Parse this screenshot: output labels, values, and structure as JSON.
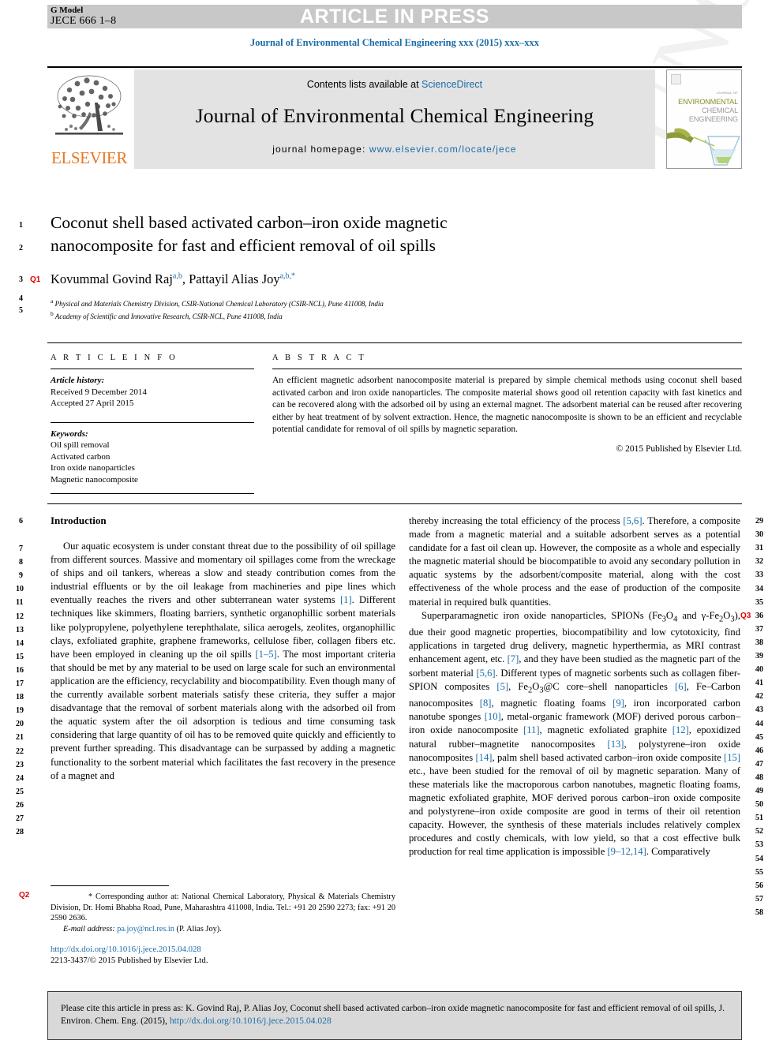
{
  "header": {
    "g_model_label": "G Model",
    "g_model_code": "JECE 666 1–8",
    "article_in_press": "ARTICLE IN PRESS",
    "journal_citation": "Journal of Environmental Chemical Engineering xxx (2015) xxx–xxx"
  },
  "masthead": {
    "publisher": "ELSEVIER",
    "contents_prefix": "Contents lists available at ",
    "contents_link": "ScienceDirect",
    "journal_title": "Journal of Environmental Chemical Engineering",
    "homepage_prefix": "journal homepage: ",
    "homepage_url": "www.elsevier.com/locate/jece",
    "cover": {
      "kicker": "JOURNAL OF",
      "line1": "ENVIRONMENTAL",
      "line2": "CHEMICAL",
      "line3": "ENGINEERING"
    }
  },
  "article": {
    "title_line1": "Coconut shell based activated carbon–iron oxide magnetic",
    "title_line2": "nanocomposite for fast and efficient removal of oil spills",
    "authors": "Kovummal Govind Raj",
    "author1_sup": "a,b",
    "authors2": ", Pattayil Alias Joy",
    "author2_sup": "a,b,*",
    "affiliation_a_sup": "a",
    "affiliation_a": " Physical and Materials Chemistry Division, CSIR-National Chemical Laboratory (CSIR-NCL), Pune 411008, India",
    "affiliation_b_sup": "b",
    "affiliation_b": " Academy of Scientific and Innovative Research, CSIR-NCL, Pune 411008, India"
  },
  "article_info": {
    "heading": "A R T I C L E  I N F O",
    "history_label": "Article history:",
    "received": "Received 9 December 2014",
    "accepted": "Accepted 27 April 2015",
    "keywords_label": "Keywords:",
    "keywords": [
      "Oil spill removal",
      "Activated carbon",
      "Iron oxide nanoparticles",
      "Magnetic nanocomposite"
    ]
  },
  "abstract": {
    "heading": "A B S T R A C T",
    "text": "An efficient magnetic adsorbent nanocomposite material is prepared by simple chemical methods using coconut shell based activated carbon and iron oxide nanoparticles. The composite material shows good oil retention capacity with fast kinetics and can be recovered along with the adsorbed oil by using an external magnet. The adsorbent material can be reused after recovering either by heat treatment of by solvent extraction. Hence, the magnetic nanocomposite is shown to be an efficient and recyclable potential candidate for removal of oil spills by magnetic separation.",
    "copyright": "© 2015 Published by Elsevier Ltd."
  },
  "body": {
    "intro_heading": "Introduction",
    "left_p1_a": "Our aquatic ecosystem is under constant threat due to the possibility of oil spillage from different sources. Massive and momentary oil spillages come from the wreckage of ships and oil tankers, whereas a slow and steady contribution comes from the industrial effluents or by the oil leakage from machineries and pipe lines which eventually reaches the rivers and other subterranean water systems ",
    "left_ref1": "[1]",
    "left_p1_b": ". Different techniques like skimmers, floating barriers, synthetic organophillic sorbent materials like polypropylene, polyethylene terephthalate, silica aerogels, zeolites, organophillic clays, exfoliated graphite, graphene frameworks, cellulose fiber, collagen fibers etc. have been employed in cleaning up the oil spills ",
    "left_ref2": "[1–5]",
    "left_p1_c": ". The most important criteria that should be met by any material to be used on large scale for such an environmental application are the efficiency, recyclability and biocompatibility. Even though many of the currently available sorbent materials satisfy these criteria, they suffer a major disadvantage that the removal of sorbent materials along with the adsorbed oil from the aquatic system after the oil adsorption is tedious and time consuming task considering that large quantity of oil has to be removed quite quickly and efficiently to prevent further spreading. This disadvantage can be surpassed by adding a magnetic functionality to the sorbent material which facilitates the fast recovery in the presence of a magnet and",
    "right_p1_a": "thereby increasing the total efficiency of the process ",
    "right_ref1": "[5,6]",
    "right_p1_b": ". Therefore, a composite made from a magnetic material and a suitable adsorbent serves as a potential candidate for a fast oil clean up. However, the composite as a whole and especially the magnetic material should be biocompatible to avoid any secondary pollution in aquatic systems by the adsorbent/composite material, along with the cost effectiveness of the whole process and the ease of production of the composite material in required bulk quantities.",
    "right_p2_a": "Superparamagnetic iron oxide nanoparticles, SPIONs (Fe",
    "right_p2_sub1": "3",
    "right_p2_b": "O",
    "right_p2_sub2": "4",
    "right_p2_c": " and γ-Fe",
    "right_p2_sub3": "2",
    "right_p2_d": "O",
    "right_p2_sub4": "3",
    "right_p2_e": "), due their good magnetic properties, biocompatibility and low cytotoxicity, find applications in targeted drug delivery, magnetic hyperthermia, as MRI contrast enhancement agent, etc. ",
    "right_ref2": "[7]",
    "right_p2_f": ", and they have been studied as the magnetic part of the sorbent material ",
    "right_ref3": "[5,6]",
    "right_p2_g": ". Different types of magnetic sorbents such as collagen fiber-SPION composites ",
    "right_ref4": "[5]",
    "right_p2_h": ", Fe",
    "right_p2_sub5": "2",
    "right_p2_i": "O",
    "right_p2_sub6": "3",
    "right_p2_j": "@C core–shell nanoparticles ",
    "right_ref5": "[6]",
    "right_p2_k": ", Fe–Carbon nanocomposites ",
    "right_ref6": "[8]",
    "right_p2_l": ", magnetic floating foams ",
    "right_ref7": "[9]",
    "right_p2_m": ", iron incorporated carbon nanotube sponges ",
    "right_ref8": "[10]",
    "right_p2_n": ", metal-organic framework (MOF) derived porous carbon–iron oxide nanocomposite ",
    "right_ref9": "[11]",
    "right_p2_o": ", magnetic exfoliated graphite ",
    "right_ref10": "[12]",
    "right_p2_p": ", epoxidized natural rubber–magnetite nanocomposites ",
    "right_ref11": "[13]",
    "right_p2_q": ", polystyrene–iron oxide nanocomposites ",
    "right_ref12": "[14]",
    "right_p2_r": ", palm shell based activated carbon–iron oxide composite ",
    "right_ref13": "[15]",
    "right_p2_s": " etc., have been studied for the removal of oil by magnetic separation. Many of these materials like the macroporous carbon nanotubes, magnetic floating foams, magnetic exfoliated graphite, MOF derived porous carbon–iron oxide composite and polystyrene–iron oxide composite are good in terms of their oil retention capacity. However, the synthesis of these materials includes relatively complex procedures and costly chemicals, with low yield, so that a cost effective bulk production for real time application is impossible ",
    "right_ref14": "[9–12,14]",
    "right_p2_t": ". Comparatively"
  },
  "footnote": {
    "marker": "*",
    "text": " Corresponding author at: National Chemical Laboratory, Physical & Materials Chemistry Division, Dr. Homi Bhabha Road, Pune, Maharashtra 411008, India. Tel.: +91 20 2590 2273; fax: +91 20 2590 2636.",
    "email_label": "E-mail address:",
    "email": "pa.joy@ncl.res.in",
    "email_owner": " (P. Alias Joy).",
    "doi_url": "http://dx.doi.org/10.1016/j.jece.2015.04.028",
    "issn_line": "2213-3437/© 2015 Published by Elsevier Ltd."
  },
  "cite_box": {
    "text_a": "Please cite this article in press as: K. Govind Raj, P. Alias Joy, Coconut shell based activated carbon–iron oxide magnetic nanocomposite for fast and efficient removal of oil spills, J. Environ. Chem. Eng. (2015), ",
    "link": "http://dx.doi.org/10.1016/j.jece.2015.04.028"
  },
  "line_numbers": {
    "left_top": [
      "1",
      "2",
      "3",
      "4",
      "5"
    ],
    "left_body": [
      "6",
      "7",
      "8",
      "9",
      "10",
      "11",
      "12",
      "13",
      "14",
      "15",
      "16",
      "17",
      "18",
      "19",
      "20",
      "21",
      "22",
      "23",
      "24",
      "25",
      "26",
      "27",
      "28"
    ],
    "right_body": [
      "29",
      "30",
      "31",
      "32",
      "33",
      "34",
      "35",
      "36",
      "37",
      "38",
      "39",
      "40",
      "41",
      "42",
      "43",
      "44",
      "45",
      "46",
      "47",
      "48",
      "49",
      "50",
      "51",
      "52",
      "53",
      "54",
      "55",
      "56",
      "57",
      "58"
    ]
  },
  "query_tags": {
    "q1": "Q1",
    "q2": "Q2",
    "q3": "Q3"
  },
  "watermark": {
    "text": "UNCORRECTED PROOF"
  },
  "colors": {
    "link": "#1a6ca8",
    "elsevier_orange": "#E87722",
    "query_red": "#e00000",
    "band_grey": "#c8c8c8",
    "panel_grey": "#e3e3e3",
    "cite_grey": "#d9d9d9"
  }
}
